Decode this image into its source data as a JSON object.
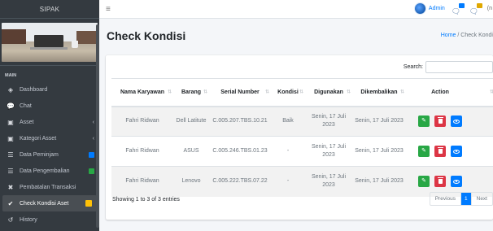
{
  "app": {
    "brand": "SIPAK"
  },
  "sidebar": {
    "section": "MAIN",
    "items": [
      {
        "label": "Dashboard",
        "icon": "gauge-icon"
      },
      {
        "label": "Chat",
        "icon": "chat-icon"
      },
      {
        "label": "Asset",
        "icon": "box-icon"
      },
      {
        "label": "Kategori Asset",
        "icon": "box-icon"
      },
      {
        "label": "Data Peminjam",
        "icon": "list-icon"
      },
      {
        "label": "Data Pengembalian",
        "icon": "list-icon"
      },
      {
        "label": "Pembatalan Transaksi",
        "icon": "x-icon"
      },
      {
        "label": "Check Kondisi Aset",
        "icon": "check-icon"
      },
      {
        "label": "History",
        "icon": "history-icon"
      }
    ]
  },
  "topbar": {
    "user": "Admin",
    "extra": "(n"
  },
  "header": {
    "title": "Check Kondisi",
    "breadcrumb_home": "Home",
    "breadcrumb_sep": "/",
    "breadcrumb_current": "Check Kondi"
  },
  "table": {
    "search_label": "Search:",
    "search_value": "",
    "columns": [
      "Nama Karyawan",
      "Barang",
      "Serial Number",
      "Kondisi",
      "Digunakan",
      "Dikembalikan",
      "Action",
      ""
    ],
    "rows": [
      {
        "nama": "Fahri Ridwan",
        "barang": "Dell Latitute",
        "serial": "C.005.207.TBS.10.21",
        "kondisi": "Baik",
        "digunakan": "Senin, 17 Juli 2023",
        "dikembalikan": "Senin, 17 Juli 2023"
      },
      {
        "nama": "Fahri Ridwan",
        "barang": "ASUS",
        "serial": "C.005.246.TBS.01.23",
        "kondisi": "-",
        "digunakan": "Senin, 17 Juli 2023",
        "dikembalikan": "Senin, 17 Juli 2023"
      },
      {
        "nama": "Fahri Ridwan",
        "barang": "Lenovo",
        "serial": "C.005.222.TBS.07.22",
        "kondisi": "-",
        "digunakan": "Senin, 17 Juli 2023",
        "dikembalikan": "Senin, 17 Juli 2023"
      }
    ],
    "info": "Showing 1 to 3 of 3 entries",
    "pager": {
      "prev": "Previous",
      "current": "1",
      "next": "Next"
    }
  },
  "colors": {
    "sidebar": "#343a40",
    "primary": "#007bff",
    "success": "#28a745",
    "danger": "#dc3545",
    "warning": "#ffc107"
  }
}
